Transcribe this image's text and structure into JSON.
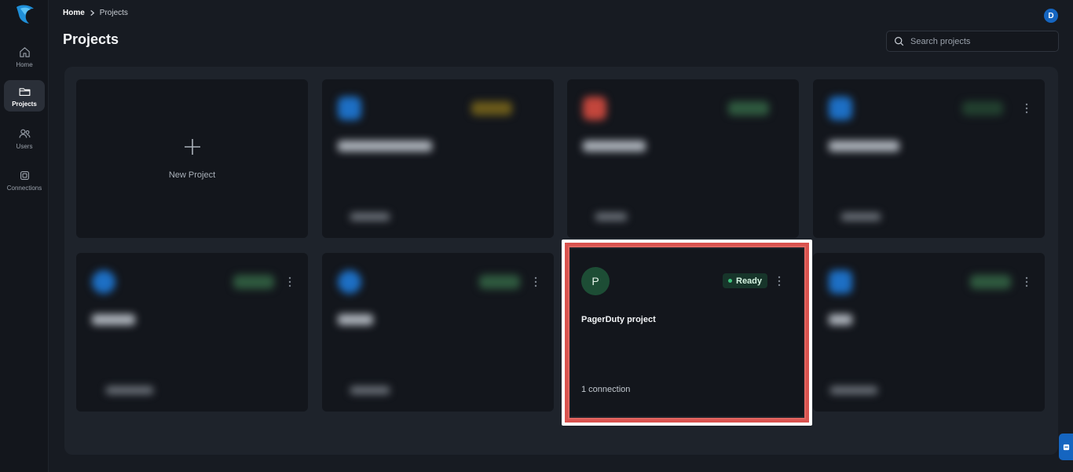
{
  "breadcrumb": {
    "home": "Home",
    "current": "Projects"
  },
  "page": {
    "title": "Projects"
  },
  "user": {
    "initial": "D"
  },
  "search": {
    "placeholder": "Search projects"
  },
  "sidebar": {
    "items": [
      {
        "label": "Home",
        "icon": "home-icon"
      },
      {
        "label": "Projects",
        "icon": "folder-icon",
        "active": true
      },
      {
        "label": "Users",
        "icon": "users-icon"
      },
      {
        "label": "Connections",
        "icon": "connections-icon"
      }
    ]
  },
  "new_project": {
    "label": "New Project"
  },
  "highlighted_card": {
    "avatar_letter": "P",
    "status": "Ready",
    "title": "PagerDuty project",
    "connections": "1 connection"
  },
  "colors": {
    "background": "#171b22",
    "board": "#1e232b",
    "card": "#13161c",
    "accent_blue": "#1565c0",
    "ready_green": "#3ec47d",
    "highlight_red": "#d9534f"
  }
}
